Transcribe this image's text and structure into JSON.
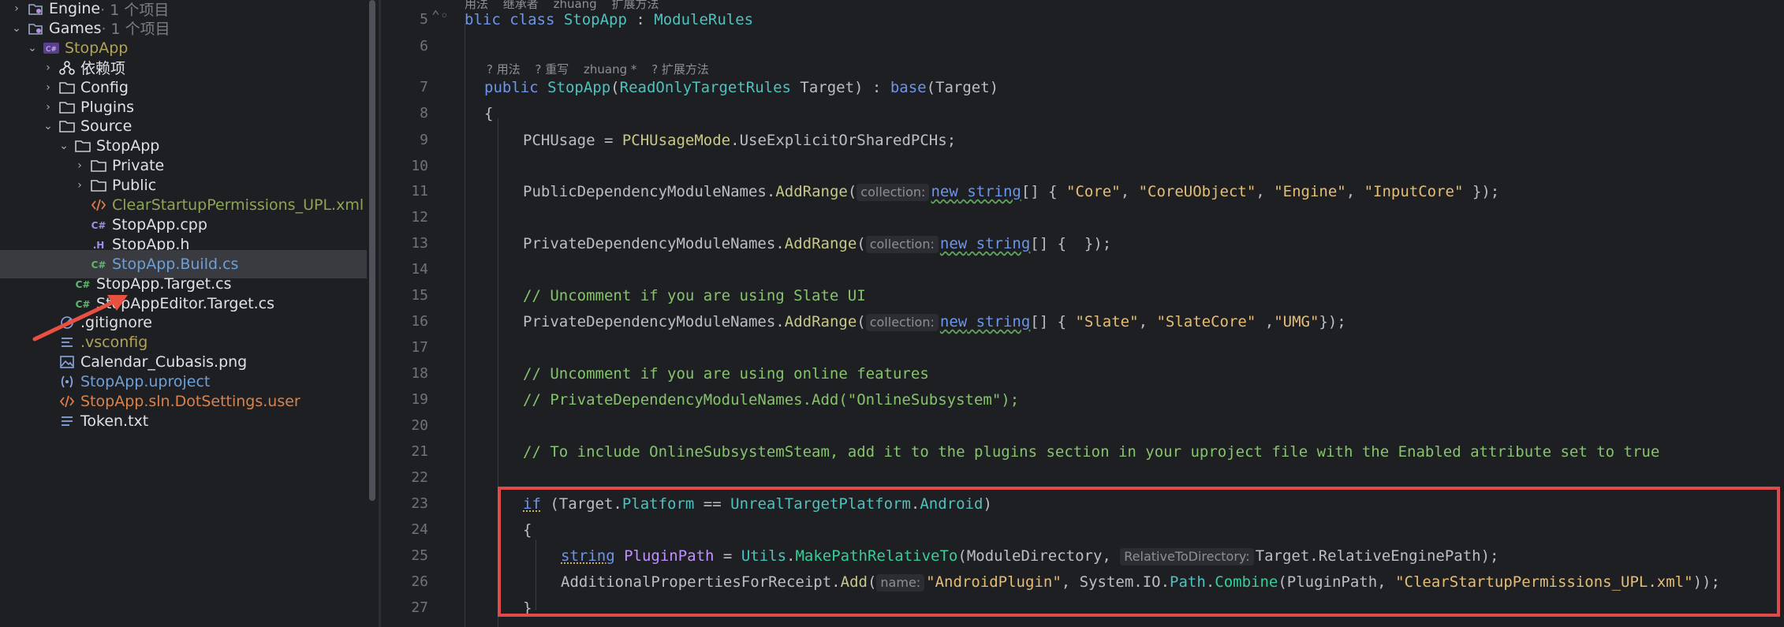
{
  "tree": [
    {
      "label": "Engine",
      "suffix": " · 1 个项目",
      "icon": "solution-folder-icon",
      "chev": "right",
      "level": 0,
      "style": ""
    },
    {
      "label": "Games",
      "suffix": " · 1 个项目",
      "icon": "solution-folder-icon",
      "chev": "down",
      "level": 0,
      "style": ""
    },
    {
      "label": "StopApp",
      "suffix": "",
      "icon": "csharp-project-icon",
      "chev": "down",
      "level": 1,
      "style": "olive"
    },
    {
      "label": "依赖项",
      "suffix": "",
      "icon": "dependencies-icon",
      "chev": "right",
      "level": 2,
      "style": ""
    },
    {
      "label": "Config",
      "suffix": "",
      "icon": "folder-icon",
      "chev": "right",
      "level": 2,
      "style": ""
    },
    {
      "label": "Plugins",
      "suffix": "",
      "icon": "folder-icon",
      "chev": "right",
      "level": 2,
      "style": ""
    },
    {
      "label": "Source",
      "suffix": "",
      "icon": "folder-icon",
      "chev": "down",
      "level": 2,
      "style": ""
    },
    {
      "label": "StopApp",
      "suffix": "",
      "icon": "folder-icon",
      "chev": "down",
      "level": 3,
      "style": ""
    },
    {
      "label": "Private",
      "suffix": "",
      "icon": "folder-icon",
      "chev": "right",
      "level": 4,
      "style": ""
    },
    {
      "label": "Public",
      "suffix": "",
      "icon": "folder-icon",
      "chev": "right",
      "level": 4,
      "style": ""
    },
    {
      "label": "ClearStartupPermissions_UPL.xml",
      "suffix": "",
      "icon": "xml-file-icon",
      "chev": "",
      "level": 4,
      "style": "green"
    },
    {
      "label": "StopApp.cpp",
      "suffix": "",
      "icon": "cpp-file-icon",
      "chev": "",
      "level": 4,
      "style": ""
    },
    {
      "label": "StopApp.h",
      "suffix": "",
      "icon": "header-file-icon",
      "chev": "",
      "level": 4,
      "style": ""
    },
    {
      "label": "StopApp.Build.cs",
      "suffix": "",
      "icon": "csharp-file-icon",
      "chev": "",
      "level": 4,
      "style": "blue",
      "selected": true
    },
    {
      "label": "StopApp.Target.cs",
      "suffix": "",
      "icon": "csharp-file-icon",
      "chev": "",
      "level": 3,
      "style": ""
    },
    {
      "label": "StopAppEditor.Target.cs",
      "suffix": "",
      "icon": "csharp-file-icon",
      "chev": "",
      "level": 3,
      "style": ""
    },
    {
      "label": ".gitignore",
      "suffix": "",
      "icon": "gitignore-file-icon",
      "chev": "",
      "level": 2,
      "style": ""
    },
    {
      "label": ".vsconfig",
      "suffix": "",
      "icon": "config-file-icon",
      "chev": "",
      "level": 2,
      "style": "olive"
    },
    {
      "label": "Calendar_Cubasis.png",
      "suffix": "",
      "icon": "image-file-icon",
      "chev": "",
      "level": 2,
      "style": ""
    },
    {
      "label": "StopApp.uproject",
      "suffix": "",
      "icon": "uproject-file-icon",
      "chev": "",
      "level": 2,
      "style": "blue"
    },
    {
      "label": "StopApp.sln.DotSettings.user",
      "suffix": "",
      "icon": "settings-file-icon",
      "chev": "",
      "level": 2,
      "style": "orange"
    },
    {
      "label": "Token.txt",
      "suffix": "",
      "icon": "text-file-icon",
      "chev": "",
      "level": 2,
      "style": ""
    }
  ],
  "lines": [
    "5",
    "6",
    "7",
    "8",
    "9",
    "10",
    "11",
    "12",
    "13",
    "14",
    "15",
    "16",
    "17",
    "18",
    "19",
    "20",
    "21",
    "22",
    "23",
    "24",
    "25",
    "26",
    "27"
  ],
  "lens_top": [
    "用法",
    "继承者",
    "zhuang",
    "扩展方法"
  ],
  "lens": [
    "? 用法",
    "? 重写",
    "zhuang *",
    "? 扩展方法"
  ],
  "code": {
    "l5_kw": "blic class",
    "l5_cls": "StopApp",
    "l5_colon": " : ",
    "l5_base": "ModuleRules",
    "l7_kw": "public",
    "l7_name": "StopApp",
    "l7_p1": "(",
    "l7_ptype": "ReadOnlyTargetRules",
    "l7_pname": " Target) : ",
    "l7_base": "base",
    "l7_p2": "(Target)",
    "l8": "{",
    "l9_a": "PCHUsage = ",
    "l9_b": "PCHUsageMode",
    "l9_c": ".",
    "l9_d": "UseExplicitOrSharedPCHs",
    "l9_e": ";",
    "l11_a": "PublicDependencyModuleNames",
    "l11_b": ".",
    "l11_c": "AddRange",
    "l11_d": "(",
    "l11_hint": "collection:",
    "l11_new": "new",
    "l11_string": " string",
    "l11_e": "[] { ",
    "l11_s1": "\"Core\"",
    "l11_s2": "\"CoreUObject\"",
    "l11_s3": "\"Engine\"",
    "l11_s4": "\"InputCore\"",
    "l11_f": " });",
    "comma": ", ",
    "l13_a": "PrivateDependencyModuleNames",
    "l13_c": "AddRange",
    "l13_hint": "collection:",
    "l13_e": "[] {  });",
    "l15": "// Uncomment if you are using Slate UI",
    "l16_a": "PrivateDependencyModuleNames",
    "l16_c": "AddRange",
    "l16_hint": "collection:",
    "l16_e": "[] { ",
    "l16_s1": "\"Slate\"",
    "l16_s2": "\"SlateCore\"",
    "l16_sep": " ,",
    "l16_s3": "\"UMG\"",
    "l16_f": "});",
    "l18": "// Uncomment if you are using online features",
    "l19": "// PrivateDependencyModuleNames.Add(\"OnlineSubsystem\");",
    "l21": "// To include OnlineSubsystemSteam, add it to the plugins section in your uproject file with the Enabled attribute set to true",
    "l23_if": "if",
    "l23_a": " (Target.",
    "l23_b": "Platform",
    "l23_c": " == ",
    "l23_d": "UnrealTargetPlatform",
    "l23_e": ".",
    "l23_f": "Android",
    "l23_g": ")",
    "l24": "{",
    "l25_type": "string",
    "l25_var": " PluginPath",
    "l25_a": " = ",
    "l25_b": "Utils",
    "l25_c": ".",
    "l25_d": "MakePathRelativeTo",
    "l25_e": "(ModuleDirectory, ",
    "l25_hint": "RelativeToDirectory:",
    "l25_f": "Target.RelativeEnginePath);",
    "l26_a": "AdditionalPropertiesForReceipt",
    "l26_b": ".",
    "l26_c": "Add",
    "l26_d": "(",
    "l26_hint": "name:",
    "l26_s1": "\"AndroidPlugin\"",
    "l26_e": ", System.IO.",
    "l26_f": "Path",
    "l26_g": ".",
    "l26_h": "Combine",
    "l26_i": "(PluginPath, ",
    "l26_s2": "\"ClearStartupPermissions_UPL.xml\"",
    "l26_j": "));",
    "l27": "}"
  },
  "colors": {
    "highlight_box": "#e04a4a",
    "arrow": "#e8503f"
  }
}
